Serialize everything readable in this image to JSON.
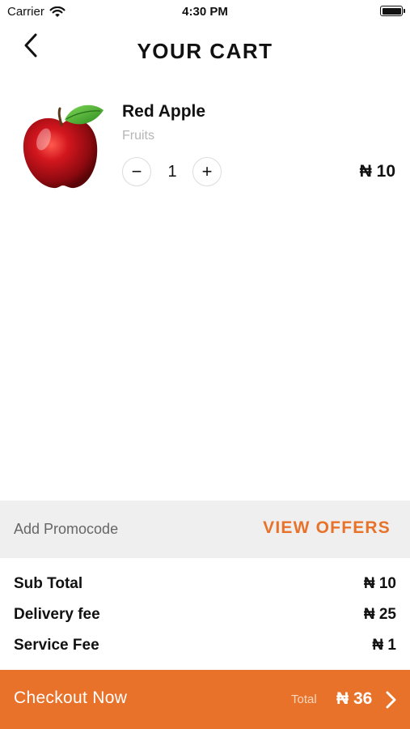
{
  "status_bar": {
    "carrier": "Carrier",
    "time": "4:30 PM",
    "icons": [
      "wifi-icon",
      "battery-icon"
    ]
  },
  "header": {
    "title": "YOUR CART",
    "back_icon": "chevron-left-icon"
  },
  "cart": {
    "items": [
      {
        "name": "Red Apple",
        "category": "Fruits",
        "quantity": "1",
        "price": "₦ 10",
        "image": "red-apple-image",
        "decrement_label": "−",
        "increment_label": "+"
      }
    ]
  },
  "promo": {
    "label": "Add Promocode",
    "action": "VIEW OFFERS"
  },
  "summary": {
    "rows": [
      {
        "label": "Sub Total",
        "value": "₦ 10"
      },
      {
        "label": "Delivery fee",
        "value": "₦ 25"
      },
      {
        "label": "Service Fee",
        "value": "₦ 1"
      }
    ]
  },
  "checkout": {
    "label": "Checkout Now",
    "total_label": "Total",
    "total_value": "₦ 36",
    "chevron_icon": "chevron-right-icon"
  },
  "colors": {
    "accent": "#e8722a",
    "promo_background": "#efefef",
    "muted_text": "#b5b5b5"
  }
}
